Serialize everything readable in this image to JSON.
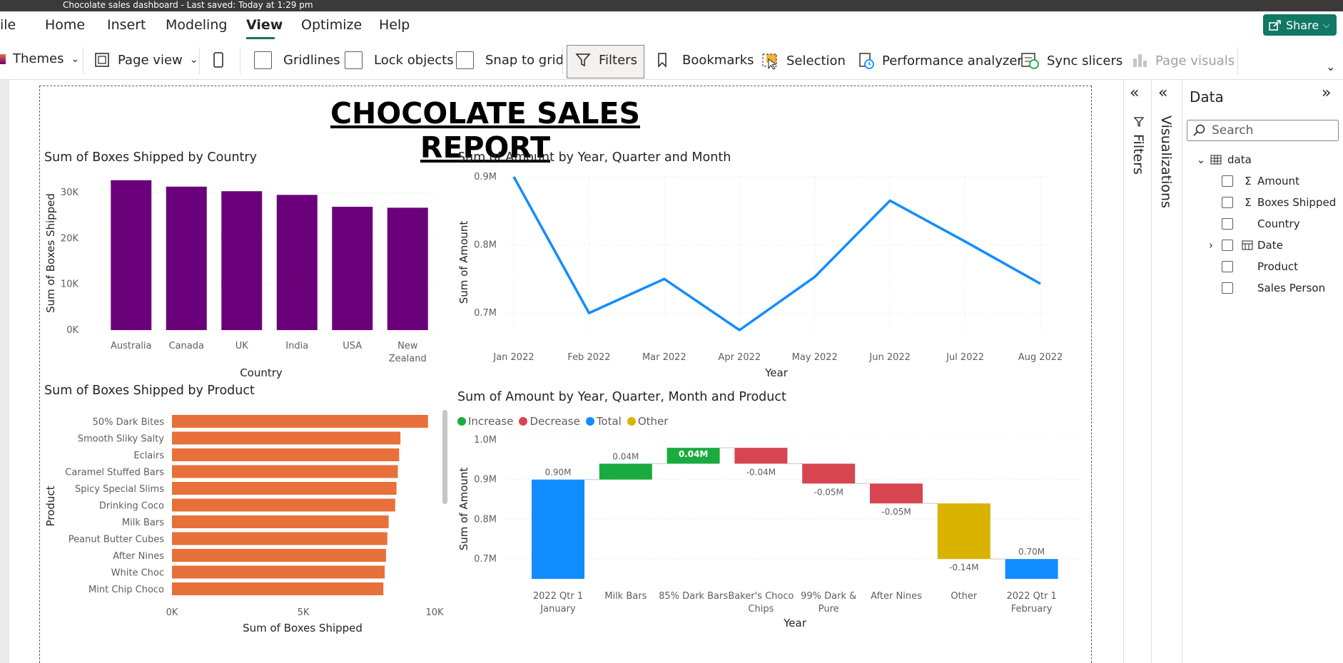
{
  "window": {
    "title": "Chocolate sales dashboard - Last saved: Today at 1:29 pm"
  },
  "menu": {
    "file": "ile",
    "items": [
      "Home",
      "Insert",
      "Modeling",
      "View",
      "Optimize",
      "Help"
    ],
    "active": "View",
    "share": "Share"
  },
  "ribbon": {
    "themes": "Themes",
    "page_view": "Page view",
    "gridlines": "Gridlines",
    "lock_objects": "Lock objects",
    "snap_to_grid": "Snap to grid",
    "filters": "Filters",
    "bookmarks": "Bookmarks",
    "selection": "Selection",
    "performance_analyzer": "Performance analyzer",
    "sync_slicers": "Sync slicers",
    "page_visuals": "Page visuals"
  },
  "report": {
    "title": "CHOCOLATE SALES REPORT",
    "chart1_title": "Sum of Boxes Shipped by Country",
    "chart2_title": "Sum of Amount by Year, Quarter and Month",
    "chart3_title": "Sum of Boxes Shipped by Product",
    "chart4_title": "Sum of Amount by Year, Quarter, Month and Product"
  },
  "chart_data": [
    {
      "type": "bar",
      "title": "Sum of Boxes Shipped by Country",
      "categories": [
        "Australia",
        "Canada",
        "UK",
        "India",
        "USA",
        "New Zealand"
      ],
      "values": [
        32700,
        31300,
        30300,
        29500,
        26900,
        26700
      ],
      "xlabel": "Country",
      "ylabel": "Sum of Boxes Shipped",
      "yticks": [
        "0K",
        "10K",
        "20K",
        "30K"
      ],
      "ylim": [
        0,
        35000
      ],
      "color": "#6b007b",
      "grid": true
    },
    {
      "type": "line",
      "title": "Sum of Amount by Year, Quarter and Month",
      "x": [
        "Jan 2022",
        "Feb 2022",
        "Mar 2022",
        "Apr 2022",
        "May 2022",
        "Jun 2022",
        "Jul 2022",
        "Aug 2022"
      ],
      "values": [
        0.9,
        0.7,
        0.75,
        0.675,
        0.753,
        0.865,
        0.805,
        0.743
      ],
      "xlabel": "Year",
      "ylabel": "Sum of Amount",
      "yticks": [
        "0.7M",
        "0.8M",
        "0.9M"
      ],
      "ylim": [
        0.675,
        0.9
      ],
      "color": "#118dff",
      "grid": true
    },
    {
      "type": "bar",
      "orientation": "horizontal",
      "title": "Sum of Boxes Shipped by Product",
      "categories": [
        "50% Dark Bites",
        "Smooth Sliky Salty",
        "Eclairs",
        "Caramel Stuffed Bars",
        "Spicy Special Slims",
        "Drinking Coco",
        "Milk Bars",
        "Peanut Butter Cubes",
        "After Nines",
        "White Choc",
        "Mint Chip Choco"
      ],
      "values": [
        9750,
        8700,
        8650,
        8600,
        8550,
        8500,
        8250,
        8200,
        8150,
        8100,
        8050
      ],
      "xlabel": "Sum of Boxes Shipped",
      "ylabel": "Product",
      "xticks": [
        "0K",
        "5K",
        "10K"
      ],
      "xlim": [
        0,
        10000
      ],
      "color": "#e8703a"
    },
    {
      "type": "waterfall",
      "title": "Sum of Amount by Year, Quarter, Month and Product",
      "categories": [
        "2022 Qtr 1 January",
        "Milk Bars",
        "85% Dark Bars",
        "Baker's Choco Chips",
        "99% Dark & Pure",
        "After Nines",
        "Other",
        "2022 Qtr 1 February"
      ],
      "values": [
        0.9,
        0.04,
        0.04,
        -0.04,
        -0.05,
        -0.05,
        -0.14,
        0.7
      ],
      "kinds": [
        "total",
        "increase",
        "increase",
        "decrease",
        "decrease",
        "decrease",
        "other",
        "total"
      ],
      "labels": [
        "0.90M",
        "0.04M",
        "0.04M",
        "-0.04M",
        "-0.05M",
        "-0.05M",
        "-0.14M",
        "0.70M"
      ],
      "legend": [
        {
          "name": "Increase",
          "color": "#1aab40"
        },
        {
          "name": "Decrease",
          "color": "#d64550"
        },
        {
          "name": "Total",
          "color": "#118dff"
        },
        {
          "name": "Other",
          "color": "#d9b300"
        }
      ],
      "xlabel": "Year",
      "ylabel": "Sum of Amount",
      "yticks": [
        "0.7M",
        "0.8M",
        "0.9M",
        "1.0M"
      ],
      "ylim": [
        0.65,
        1.0
      ]
    }
  ],
  "panes": {
    "filters": "Filters",
    "visualizations": "Visualizations",
    "data": {
      "title": "Data",
      "search_placeholder": "Search",
      "table": "data",
      "fields": [
        {
          "name": "Amount",
          "icon": "sigma-icon"
        },
        {
          "name": "Boxes Shipped",
          "icon": "sigma-icon"
        },
        {
          "name": "Country",
          "icon": ""
        },
        {
          "name": "Date",
          "icon": "calendar-icon"
        },
        {
          "name": "Product",
          "icon": ""
        },
        {
          "name": "Sales Person",
          "icon": ""
        }
      ]
    }
  }
}
